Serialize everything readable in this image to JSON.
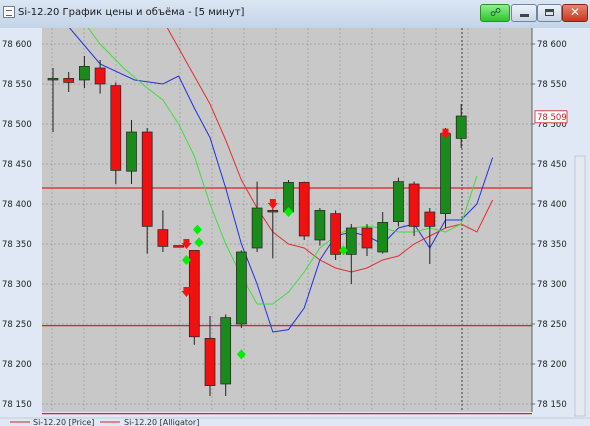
{
  "window": {
    "title": "Si-12.20 График цены и объёма - [5 минут]"
  },
  "colors": {
    "plot_bg": "#c8c8c8",
    "bull": "#1a8a1a",
    "bear": "#f01010",
    "level_line": "#e02020",
    "blue_line": "#2030e0",
    "red_line": "#e03030",
    "green_line": "#40dd40"
  },
  "icons": [
    "window-icon",
    "link-icon",
    "minimize-icon",
    "maximize-icon",
    "close-icon"
  ],
  "legend": [
    {
      "label": "Si-12.20 [Price]",
      "color": "#e02020"
    },
    {
      "label": "Si-12.20 [Alligator]",
      "color": "#e02020"
    }
  ],
  "chart_data": {
    "type": "candlestick",
    "ylim": [
      78140,
      78620
    ],
    "yticks": [
      "78 600",
      "78 550",
      "78 500",
      "78 450",
      "78 400",
      "78 350",
      "78 300",
      "78 250",
      "78 200",
      "78 150"
    ],
    "price_label": "78 509",
    "last_price": 78509,
    "levels": [
      78420,
      78248,
      78138
    ],
    "candles": [
      {
        "o": 78555,
        "h": 78570,
        "l": 78490,
        "c": 78557
      },
      {
        "o": 78557,
        "h": 78565,
        "l": 78540,
        "c": 78552
      },
      {
        "o": 78555,
        "h": 78585,
        "l": 78545,
        "c": 78572
      },
      {
        "o": 78570,
        "h": 78580,
        "l": 78538,
        "c": 78550
      },
      {
        "o": 78548,
        "h": 78552,
        "l": 78425,
        "c": 78442
      },
      {
        "o": 78441,
        "h": 78505,
        "l": 78425,
        "c": 78490
      },
      {
        "o": 78490,
        "h": 78495,
        "l": 78338,
        "c": 78372
      },
      {
        "o": 78368,
        "h": 78392,
        "l": 78340,
        "c": 78347
      },
      {
        "o": 78348,
        "h": 78340,
        "l": 78350,
        "c": 78346
      },
      {
        "o": 78342,
        "h": 78342,
        "l": 78224,
        "c": 78234
      },
      {
        "o": 78232,
        "h": 78260,
        "l": 78160,
        "c": 78173
      },
      {
        "o": 78175,
        "h": 78262,
        "l": 78160,
        "c": 78258
      },
      {
        "o": 78250,
        "h": 78342,
        "l": 78245,
        "c": 78340
      },
      {
        "o": 78345,
        "h": 78428,
        "l": 78340,
        "c": 78395
      },
      {
        "o": 78392,
        "h": 78395,
        "l": 78332,
        "c": 78390
      },
      {
        "o": 78390,
        "h": 78430,
        "l": 78385,
        "c": 78427
      },
      {
        "o": 78427,
        "h": 78428,
        "l": 78355,
        "c": 78360
      },
      {
        "o": 78355,
        "h": 78395,
        "l": 78348,
        "c": 78392
      },
      {
        "o": 78388,
        "h": 78392,
        "l": 78330,
        "c": 78337
      },
      {
        "o": 78337,
        "h": 78375,
        "l": 78300,
        "c": 78370
      },
      {
        "o": 78370,
        "h": 78375,
        "l": 78335,
        "c": 78345
      },
      {
        "o": 78340,
        "h": 78390,
        "l": 78338,
        "c": 78377
      },
      {
        "o": 78378,
        "h": 78433,
        "l": 78372,
        "c": 78428
      },
      {
        "o": 78425,
        "h": 78428,
        "l": 78360,
        "c": 78372
      },
      {
        "o": 78390,
        "h": 78395,
        "l": 78325,
        "c": 78372
      },
      {
        "o": 78388,
        "h": 78495,
        "l": 78370,
        "c": 78488
      },
      {
        "o": 78482,
        "h": 78525,
        "l": 78470,
        "c": 78510
      }
    ],
    "lines": [
      {
        "color": "#2030e0",
        "points": [
          [
            0.2,
            78640
          ],
          [
            3,
            78575
          ],
          [
            5.2,
            78555
          ],
          [
            7,
            78550
          ],
          [
            8,
            78560
          ],
          [
            9,
            78520
          ],
          [
            10,
            78483
          ],
          [
            11,
            78420
          ],
          [
            12,
            78350
          ],
          [
            13,
            78300
          ],
          [
            14,
            78240
          ],
          [
            15,
            78243
          ],
          [
            16,
            78270
          ],
          [
            17,
            78330
          ],
          [
            18,
            78360
          ],
          [
            19,
            78365
          ],
          [
            20,
            78360
          ],
          [
            21,
            78350
          ],
          [
            22,
            78370
          ],
          [
            23,
            78375
          ],
          [
            24,
            78345
          ],
          [
            25,
            78380
          ],
          [
            26,
            78380
          ],
          [
            27,
            78400
          ],
          [
            28,
            78458
          ]
        ]
      },
      {
        "color": "#e03030",
        "points": [
          [
            5.2,
            78660
          ],
          [
            7,
            78630
          ],
          [
            8,
            78595
          ],
          [
            9,
            78560
          ],
          [
            10,
            78525
          ],
          [
            11,
            78480
          ],
          [
            12,
            78430
          ],
          [
            13,
            78395
          ],
          [
            14,
            78365
          ],
          [
            15,
            78350
          ],
          [
            16,
            78345
          ],
          [
            17,
            78330
          ],
          [
            18,
            78320
          ],
          [
            19,
            78315
          ],
          [
            20,
            78320
          ],
          [
            21,
            78330
          ],
          [
            22,
            78335
          ],
          [
            23,
            78350
          ],
          [
            24,
            78360
          ],
          [
            25,
            78370
          ],
          [
            26,
            78375
          ],
          [
            27,
            78365
          ],
          [
            28,
            78405
          ]
        ]
      },
      {
        "color": "#40dd40",
        "points": [
          [
            1.5,
            78640
          ],
          [
            3,
            78600
          ],
          [
            4.5,
            78570
          ],
          [
            6,
            78545
          ],
          [
            7,
            78530
          ],
          [
            8,
            78500
          ],
          [
            9,
            78460
          ],
          [
            10,
            78400
          ],
          [
            11,
            78350
          ],
          [
            12,
            78310
          ],
          [
            13,
            78275
          ],
          [
            14,
            78275
          ],
          [
            15,
            78290
          ],
          [
            16,
            78315
          ],
          [
            17,
            78345
          ],
          [
            18,
            78360
          ],
          [
            19,
            78370
          ],
          [
            20,
            78372
          ],
          [
            21,
            78370
          ],
          [
            22,
            78365
          ],
          [
            23,
            78365
          ],
          [
            24,
            78370
          ],
          [
            25,
            78365
          ],
          [
            26,
            78375
          ],
          [
            27,
            78435
          ]
        ]
      }
    ],
    "markers": [
      {
        "type": "diamond",
        "color": "#00ee00",
        "i": 8.5,
        "p": 78330
      },
      {
        "type": "diamond",
        "color": "#00ee00",
        "i": 9.3,
        "p": 78352
      },
      {
        "type": "diamond",
        "color": "#00ee00",
        "i": 9.2,
        "p": 78368
      },
      {
        "type": "diamond",
        "color": "#00ee00",
        "i": 12.0,
        "p": 78212
      },
      {
        "type": "diamond",
        "color": "#00ee00",
        "i": 15.0,
        "p": 78390
      },
      {
        "type": "diamond",
        "color": "#00ee00",
        "i": 18.5,
        "p": 78342
      },
      {
        "type": "arrow-down",
        "color": "#ff1010",
        "i": 8.5,
        "p": 78290
      },
      {
        "type": "arrow-down",
        "color": "#ff1010",
        "i": 8.5,
        "p": 78350
      },
      {
        "type": "arrow-down",
        "color": "#ff1010",
        "i": 14.0,
        "p": 78400
      },
      {
        "type": "arrow-down",
        "color": "#ff1010",
        "i": 25.0,
        "p": 78488
      }
    ]
  }
}
